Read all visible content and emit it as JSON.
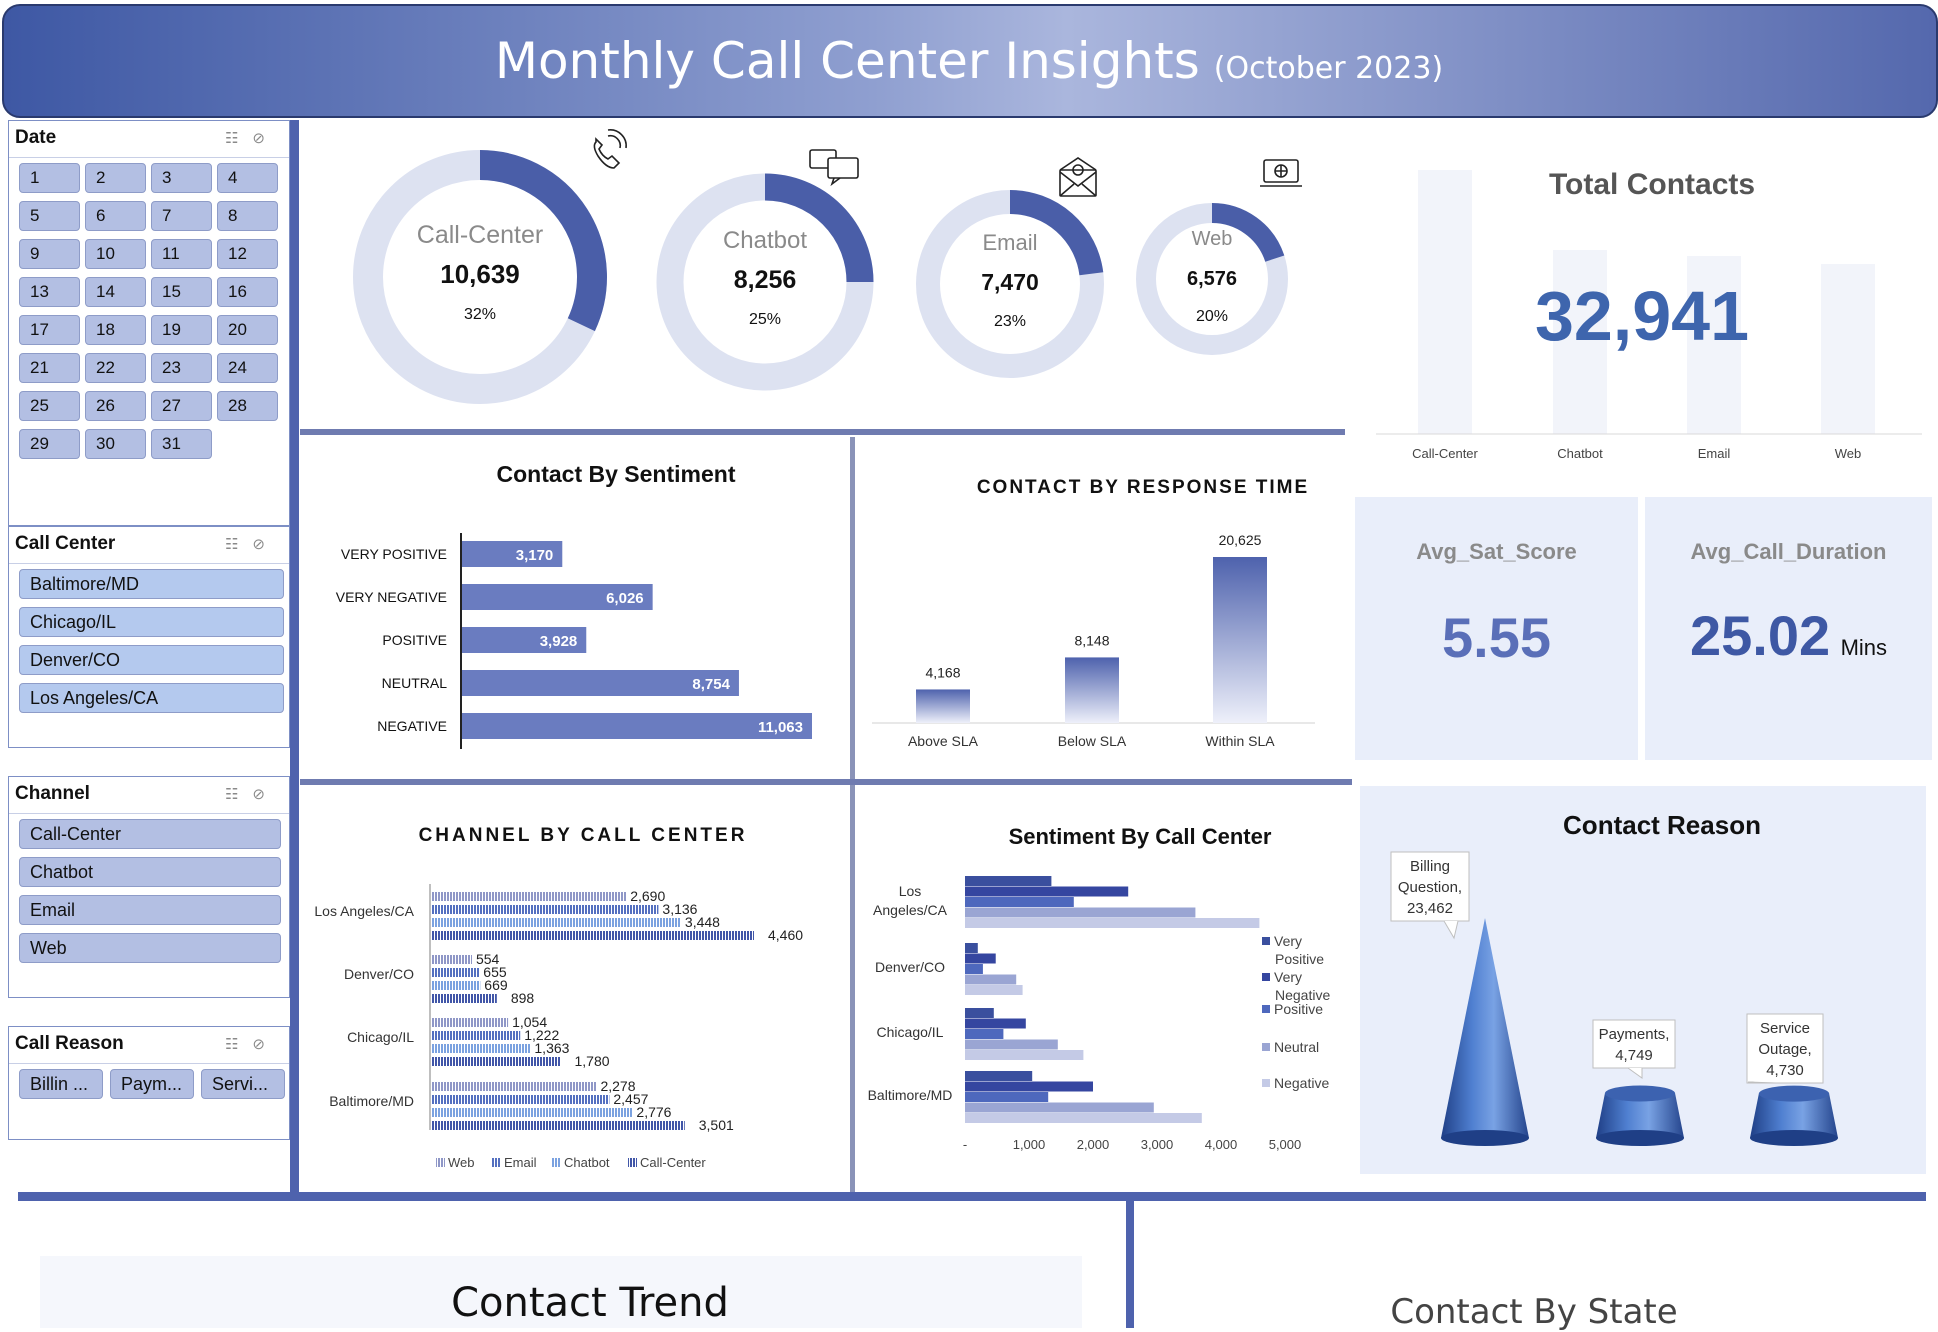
{
  "header": {
    "title": "Monthly Call Center Insights",
    "subtitle": "(October 2023)"
  },
  "slicers": {
    "date": {
      "title": "Date",
      "days": [
        "1",
        "2",
        "3",
        "4",
        "5",
        "6",
        "7",
        "8",
        "9",
        "10",
        "11",
        "12",
        "13",
        "14",
        "15",
        "16",
        "17",
        "18",
        "19",
        "20",
        "21",
        "22",
        "23",
        "24",
        "25",
        "26",
        "27",
        "28",
        "29",
        "30",
        "31"
      ]
    },
    "call_center": {
      "title": "Call Center",
      "items": [
        "Baltimore/MD",
        "Chicago/IL",
        "Denver/CO",
        "Los Angeles/CA"
      ]
    },
    "channel": {
      "title": "Channel",
      "items": [
        "Call-Center",
        "Chatbot",
        "Email",
        "Web"
      ]
    },
    "call_reason": {
      "title": "Call Reason",
      "items": [
        "Billin ...",
        "Paym...",
        "Servi..."
      ]
    },
    "icons": {
      "multi_select": "multi-select-icon",
      "clear_filter": "clear-filter-icon"
    }
  },
  "donuts": [
    {
      "label": "Call-Center",
      "value": "10,639",
      "pct": "32%",
      "fraction": 0.32,
      "icon": "phone-icon"
    },
    {
      "label": "Chatbot",
      "value": "8,256",
      "pct": "25%",
      "fraction": 0.25,
      "icon": "chat-icon"
    },
    {
      "label": "Email",
      "value": "7,470",
      "pct": "23%",
      "fraction": 0.23,
      "icon": "email-icon"
    },
    {
      "label": "Web",
      "value": "6,576",
      "pct": "20%",
      "fraction": 0.2,
      "icon": "web-icon"
    }
  ],
  "total_contacts": {
    "title": "Total Contacts",
    "value": "32,941",
    "bar_labels": [
      "Call-Center",
      "Chatbot",
      "Email",
      "Web"
    ]
  },
  "kpis": {
    "sat": {
      "label": "Avg_Sat_Score",
      "value": "5.55"
    },
    "duration": {
      "label": "Avg_Call_Duration",
      "value": "25.02",
      "unit": "Mins"
    }
  },
  "bottom": {
    "contact_trend": "Contact Trend",
    "contact_by_state": "Contact By State"
  },
  "colors": {
    "accent": "#4e62ad",
    "bar": "#6a7cc0",
    "track": "#dde2f1",
    "dark_blue": "#3e58a4"
  },
  "chart_data": [
    {
      "type": "bar",
      "orientation": "horizontal",
      "title": "Contact By Sentiment",
      "categories": [
        "VERY POSITIVE",
        "VERY NEGATIVE",
        "POSITIVE",
        "NEUTRAL",
        "NEGATIVE"
      ],
      "values": [
        3170,
        6026,
        3928,
        8754,
        11063
      ],
      "labels": [
        "3,170",
        "6,026",
        "3,928",
        "8,754",
        "11,063"
      ]
    },
    {
      "type": "bar",
      "title": "CONTACT BY RESPONSE TIME",
      "categories": [
        "Above SLA",
        "Below SLA",
        "Within SLA"
      ],
      "values": [
        4168,
        8148,
        20625
      ],
      "labels": [
        "4,168",
        "8,148",
        "20,625"
      ]
    },
    {
      "type": "bar",
      "orientation": "horizontal",
      "title": "CHANNEL BY CALL CENTER",
      "categories": [
        "Los Angeles/CA",
        "Denver/CO",
        "Chicago/IL",
        "Baltimore/MD"
      ],
      "series": [
        {
          "name": "Web",
          "values": [
            2690,
            554,
            1054,
            2278
          ],
          "labels": [
            "2,690",
            "554",
            "1,054",
            "2,278"
          ]
        },
        {
          "name": "Email",
          "values": [
            3136,
            655,
            1222,
            2457
          ],
          "labels": [
            "3,136",
            "655",
            "1,222",
            "2,457"
          ]
        },
        {
          "name": "Chatbot",
          "values": [
            3448,
            669,
            1363,
            2776
          ],
          "labels": [
            "3,448",
            "669",
            "1,363",
            "2,776"
          ]
        },
        {
          "name": "Call-Center",
          "values": [
            4460,
            898,
            1780,
            3501
          ],
          "labels": [
            "4,460",
            "898",
            "1,780",
            "3,501"
          ]
        }
      ],
      "legend": "bottom"
    },
    {
      "type": "bar",
      "orientation": "horizontal",
      "title": "Sentiment By Call Center",
      "categories": [
        "Los Angeles/CA",
        "Denver/CO",
        "Chicago/IL",
        "Baltimore/MD"
      ],
      "category_lines": [
        [
          "Los",
          "Angeles/CA"
        ],
        [
          "Denver/CO"
        ],
        [
          "Chicago/IL"
        ],
        [
          "Baltimore/MD"
        ]
      ],
      "series": [
        {
          "name": "Very Positive",
          "name_lines": [
            "Very",
            "Positive"
          ],
          "values": [
            1350,
            200,
            450,
            1050
          ]
        },
        {
          "name": "Very Negative",
          "name_lines": [
            "Very",
            "Negative"
          ],
          "values": [
            2550,
            480,
            950,
            2000
          ]
        },
        {
          "name": "Positive",
          "name_lines": [
            "Positive"
          ],
          "values": [
            1700,
            280,
            600,
            1300
          ]
        },
        {
          "name": "Neutral",
          "name_lines": [
            "Neutral"
          ],
          "values": [
            3600,
            800,
            1450,
            2950
          ]
        },
        {
          "name": "Negative",
          "name_lines": [
            "Negative"
          ],
          "values": [
            4600,
            900,
            1850,
            3700
          ]
        }
      ],
      "xticks": [
        "-",
        "1,000",
        "2,000",
        "3,000",
        "4,000",
        "5,000"
      ],
      "xlim": [
        0,
        5000
      ],
      "legend": "right"
    },
    {
      "type": "bar",
      "title": "Contact Reason",
      "style": "3d-cone",
      "categories": [
        "Billing Question",
        "Payments",
        "Service Outage"
      ],
      "values": [
        23462,
        4749,
        4730
      ],
      "label_lines": [
        [
          "Billing",
          "Question,",
          "23,462"
        ],
        [
          "Payments,",
          "4,749"
        ],
        [
          "Service",
          "Outage,",
          "4,730"
        ]
      ]
    }
  ]
}
